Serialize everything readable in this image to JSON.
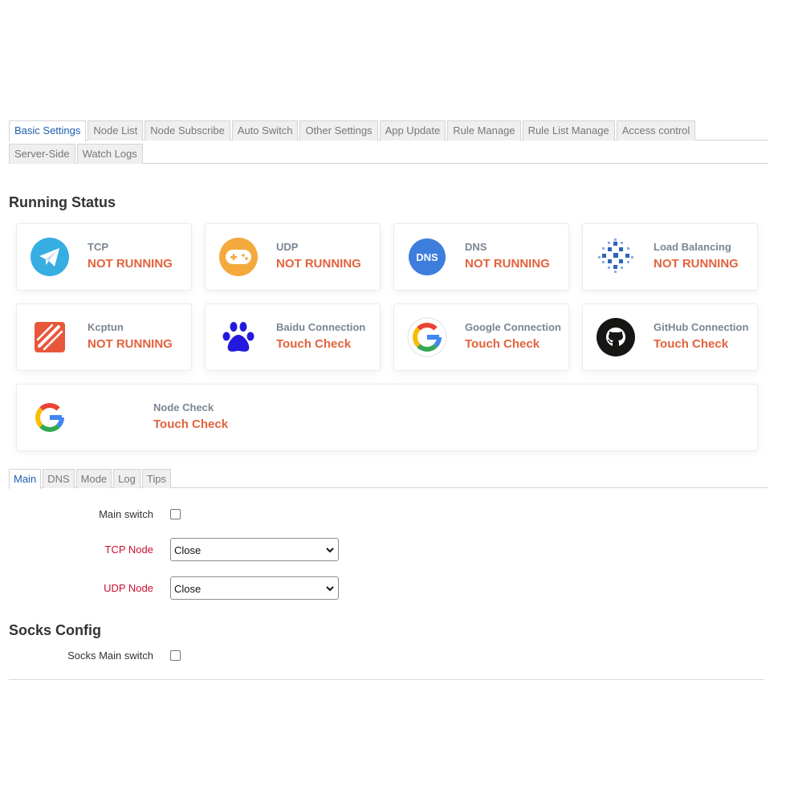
{
  "tabs_row1": [
    "Basic Settings",
    "Node List",
    "Node Subscribe",
    "Auto Switch",
    "Other Settings",
    "App Update",
    "Rule Manage",
    "Rule List Manage",
    "Access control"
  ],
  "tabs_row2": [
    "Server-Side",
    "Watch Logs"
  ],
  "running_status": {
    "title": "Running Status",
    "cards": [
      {
        "label": "TCP",
        "value": "NOT RUNNING",
        "icon": "telegram-plane-icon"
      },
      {
        "label": "UDP",
        "value": "NOT RUNNING",
        "icon": "gamepad-icon"
      },
      {
        "label": "DNS",
        "value": "NOT RUNNING",
        "icon": "dns-icon",
        "icon_text": "DNS"
      },
      {
        "label": "Load Balancing",
        "value": "NOT RUNNING",
        "icon": "load-balancing-icon"
      },
      {
        "label": "Kcptun",
        "value": "NOT RUNNING",
        "icon": "kcptun-icon"
      },
      {
        "label": "Baidu Connection",
        "value": "Touch Check",
        "icon": "baidu-paw-icon"
      },
      {
        "label": "Google Connection",
        "value": "Touch Check",
        "icon": "google-icon"
      },
      {
        "label": "GitHub Connection",
        "value": "Touch Check",
        "icon": "github-icon"
      },
      {
        "label": "Node Check",
        "value": "Touch Check",
        "icon": "google-icon"
      }
    ]
  },
  "sub_tabs": [
    "Main",
    "DNS",
    "Mode",
    "Log",
    "Tips"
  ],
  "main_form": {
    "main_switch_label": "Main switch",
    "tcp_node_label": "TCP Node",
    "tcp_node_value": "Close",
    "udp_node_label": "UDP Node",
    "udp_node_value": "Close"
  },
  "socks": {
    "title": "Socks Config",
    "main_switch_label": "Socks Main switch"
  },
  "colors": {
    "accent": "#1f5fae",
    "status_red": "#e2623d",
    "label_red": "#c8102e"
  }
}
